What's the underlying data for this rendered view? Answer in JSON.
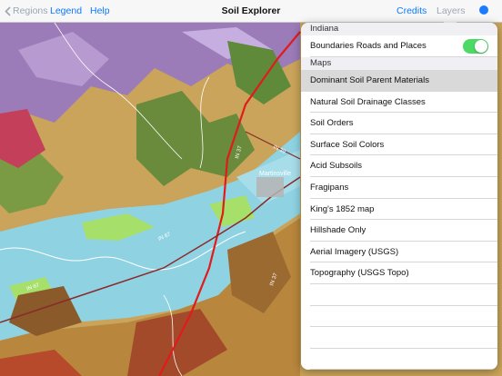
{
  "navbar": {
    "back_label": "Regions",
    "legend_label": "Legend",
    "help_label": "Help",
    "title": "Soil Explorer",
    "credits_label": "Credits",
    "layers_label": "Layers"
  },
  "map": {
    "road_labels": [
      "IN 67",
      "IN 37",
      "IN 67",
      "IN 37",
      "IN 39"
    ],
    "city_label": "Martinsville"
  },
  "layers_panel": {
    "state_header": "Indiana",
    "boundaries_label": "Boundaries Roads and Places",
    "boundaries_on": true,
    "maps_header": "Maps",
    "map_items": [
      "Dominant Soil Parent Materials",
      "Natural Soil Drainage Classes",
      "Soil Orders",
      "Surface Soil Colors",
      "Acid Subsoils",
      "Fragipans",
      "King's 1852 map",
      "Hillshade Only",
      "Aerial Imagery (USGS)",
      "Topography (USGS Topo)"
    ],
    "selected_index": 0
  },
  "colors": {
    "accent": "#0a7aff",
    "toggle_on": "#4cd964",
    "floodplain": "#8fd3e3",
    "outwash": "#a6e06a",
    "till": "#c9a45a",
    "loess": "#9b7bb8",
    "bedrock": "#6a8a3c",
    "road": "#e11b1b"
  }
}
